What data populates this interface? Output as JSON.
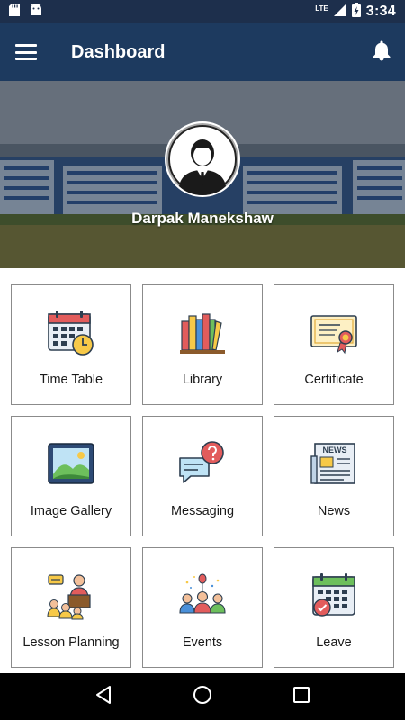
{
  "status_bar": {
    "time": "3:34",
    "network": "LTE",
    "icons": [
      "sd-card-icon",
      "android-icon",
      "signal-icon",
      "battery-charging-icon"
    ]
  },
  "app_bar": {
    "title": "Dashboard",
    "menu_icon": "hamburger-menu-icon",
    "notification_icon": "bell-icon"
  },
  "profile": {
    "name": "Darpak Manekshaw",
    "avatar_icon": "user-avatar-icon"
  },
  "tiles": [
    {
      "label": "Time Table",
      "icon": "timetable-calendar-clock-icon"
    },
    {
      "label": "Library",
      "icon": "books-icon"
    },
    {
      "label": "Certificate",
      "icon": "certificate-icon"
    },
    {
      "label": "Image Gallery",
      "icon": "image-gallery-icon"
    },
    {
      "label": "Messaging",
      "icon": "chat-bubbles-icon"
    },
    {
      "label": "News",
      "icon": "newspaper-icon"
    },
    {
      "label": "Lesson Planning",
      "icon": "lecture-presenter-icon"
    },
    {
      "label": "Events",
      "icon": "people-celebration-icon"
    },
    {
      "label": "Leave",
      "icon": "calendar-check-icon"
    }
  ],
  "nav_bar": {
    "buttons": [
      "back-icon",
      "home-icon",
      "recents-icon"
    ]
  },
  "colors": {
    "status_bar": "#1d2f4c",
    "app_bar": "#1d3a5f",
    "tile_border": "#8b8b8b"
  }
}
